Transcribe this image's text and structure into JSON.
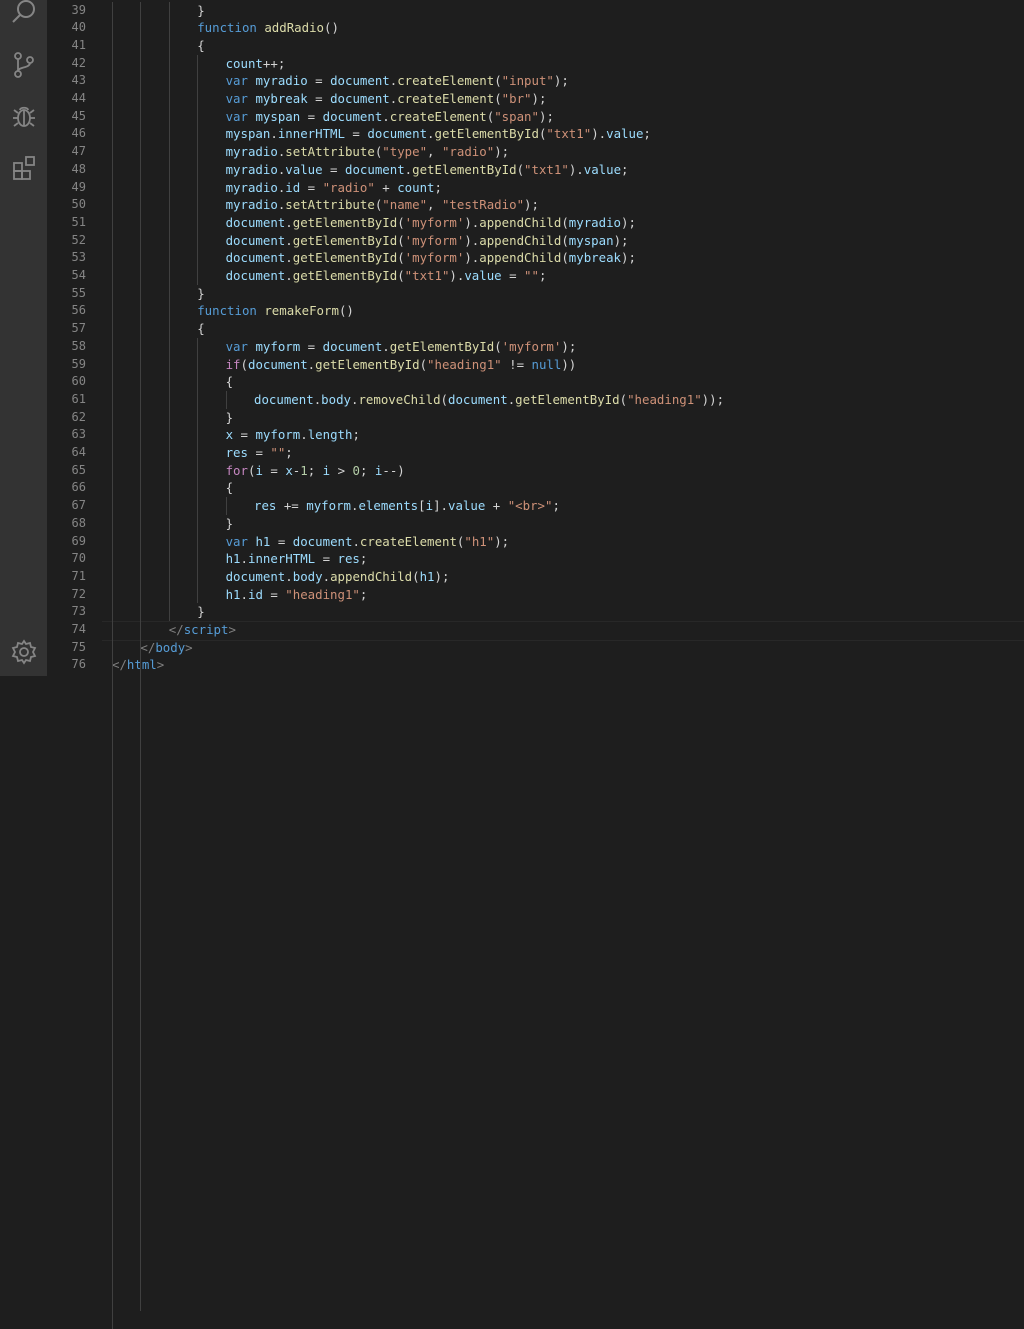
{
  "activity_bar": {
    "icons": [
      "search-icon",
      "source-control-icon",
      "debug-icon",
      "extensions-icon",
      "settings-gear-icon"
    ]
  },
  "colors": {
    "background": "#1e1e1e",
    "activity_bar": "#333333",
    "line_number": "#858585",
    "keyword": "#569cd6",
    "control": "#c586c0",
    "function": "#dcdcaa",
    "variable": "#9cdcfe",
    "string": "#ce9178",
    "number": "#b5cea8"
  },
  "editor": {
    "lines": [
      {
        "n": "39",
        "indent": 3,
        "tokens": [
          [
            "p",
            "}"
          ]
        ]
      },
      {
        "n": "40",
        "indent": 3,
        "tokens": [
          [
            "k",
            "function"
          ],
          [
            "p",
            " "
          ],
          [
            "f",
            "addRadio"
          ],
          [
            "p",
            "()"
          ]
        ]
      },
      {
        "n": "41",
        "indent": 3,
        "tokens": [
          [
            "p",
            "{"
          ]
        ]
      },
      {
        "n": "42",
        "indent": 4,
        "tokens": [
          [
            "v",
            "count"
          ],
          [
            "p",
            "++;"
          ]
        ]
      },
      {
        "n": "43",
        "indent": 4,
        "tokens": [
          [
            "k",
            "var"
          ],
          [
            "p",
            " "
          ],
          [
            "v",
            "myradio"
          ],
          [
            "p",
            " = "
          ],
          [
            "v",
            "document"
          ],
          [
            "p",
            "."
          ],
          [
            "f",
            "createElement"
          ],
          [
            "p",
            "("
          ],
          [
            "s",
            "\"input\""
          ],
          [
            "p",
            ");"
          ]
        ]
      },
      {
        "n": "44",
        "indent": 4,
        "tokens": [
          [
            "k",
            "var"
          ],
          [
            "p",
            " "
          ],
          [
            "v",
            "mybreak"
          ],
          [
            "p",
            " = "
          ],
          [
            "v",
            "document"
          ],
          [
            "p",
            "."
          ],
          [
            "f",
            "createElement"
          ],
          [
            "p",
            "("
          ],
          [
            "s",
            "\"br\""
          ],
          [
            "p",
            ");"
          ]
        ]
      },
      {
        "n": "45",
        "indent": 4,
        "tokens": [
          [
            "k",
            "var"
          ],
          [
            "p",
            " "
          ],
          [
            "v",
            "myspan"
          ],
          [
            "p",
            " = "
          ],
          [
            "v",
            "document"
          ],
          [
            "p",
            "."
          ],
          [
            "f",
            "createElement"
          ],
          [
            "p",
            "("
          ],
          [
            "s",
            "\"span\""
          ],
          [
            "p",
            ");"
          ]
        ]
      },
      {
        "n": "46",
        "indent": 4,
        "tokens": [
          [
            "v",
            "myspan"
          ],
          [
            "p",
            "."
          ],
          [
            "v",
            "innerHTML"
          ],
          [
            "p",
            " = "
          ],
          [
            "v",
            "document"
          ],
          [
            "p",
            "."
          ],
          [
            "f",
            "getElementById"
          ],
          [
            "p",
            "("
          ],
          [
            "s",
            "\"txt1\""
          ],
          [
            "p",
            ")."
          ],
          [
            "v",
            "value"
          ],
          [
            "p",
            ";"
          ]
        ]
      },
      {
        "n": "47",
        "indent": 4,
        "tokens": [
          [
            "v",
            "myradio"
          ],
          [
            "p",
            "."
          ],
          [
            "f",
            "setAttribute"
          ],
          [
            "p",
            "("
          ],
          [
            "s",
            "\"type\""
          ],
          [
            "p",
            ", "
          ],
          [
            "s",
            "\"radio\""
          ],
          [
            "p",
            ");"
          ]
        ]
      },
      {
        "n": "48",
        "indent": 4,
        "tokens": [
          [
            "v",
            "myradio"
          ],
          [
            "p",
            "."
          ],
          [
            "v",
            "value"
          ],
          [
            "p",
            " = "
          ],
          [
            "v",
            "document"
          ],
          [
            "p",
            "."
          ],
          [
            "f",
            "getElementById"
          ],
          [
            "p",
            "("
          ],
          [
            "s",
            "\"txt1\""
          ],
          [
            "p",
            ")."
          ],
          [
            "v",
            "value"
          ],
          [
            "p",
            ";"
          ]
        ]
      },
      {
        "n": "49",
        "indent": 4,
        "tokens": [
          [
            "v",
            "myradio"
          ],
          [
            "p",
            "."
          ],
          [
            "v",
            "id"
          ],
          [
            "p",
            " = "
          ],
          [
            "s",
            "\"radio\""
          ],
          [
            "p",
            " + "
          ],
          [
            "v",
            "count"
          ],
          [
            "p",
            ";"
          ]
        ]
      },
      {
        "n": "50",
        "indent": 4,
        "tokens": [
          [
            "v",
            "myradio"
          ],
          [
            "p",
            "."
          ],
          [
            "f",
            "setAttribute"
          ],
          [
            "p",
            "("
          ],
          [
            "s",
            "\"name\""
          ],
          [
            "p",
            ", "
          ],
          [
            "s",
            "\"testRadio\""
          ],
          [
            "p",
            ");"
          ]
        ]
      },
      {
        "n": "51",
        "indent": 4,
        "tokens": [
          [
            "v",
            "document"
          ],
          [
            "p",
            "."
          ],
          [
            "f",
            "getElementById"
          ],
          [
            "p",
            "("
          ],
          [
            "s",
            "'myform'"
          ],
          [
            "p",
            ")."
          ],
          [
            "f",
            "appendChild"
          ],
          [
            "p",
            "("
          ],
          [
            "v",
            "myradio"
          ],
          [
            "p",
            ");"
          ]
        ]
      },
      {
        "n": "52",
        "indent": 4,
        "tokens": [
          [
            "v",
            "document"
          ],
          [
            "p",
            "."
          ],
          [
            "f",
            "getElementById"
          ],
          [
            "p",
            "("
          ],
          [
            "s",
            "'myform'"
          ],
          [
            "p",
            ")."
          ],
          [
            "f",
            "appendChild"
          ],
          [
            "p",
            "("
          ],
          [
            "v",
            "myspan"
          ],
          [
            "p",
            ");"
          ]
        ]
      },
      {
        "n": "53",
        "indent": 4,
        "tokens": [
          [
            "v",
            "document"
          ],
          [
            "p",
            "."
          ],
          [
            "f",
            "getElementById"
          ],
          [
            "p",
            "("
          ],
          [
            "s",
            "'myform'"
          ],
          [
            "p",
            ")."
          ],
          [
            "f",
            "appendChild"
          ],
          [
            "p",
            "("
          ],
          [
            "v",
            "mybreak"
          ],
          [
            "p",
            ");"
          ]
        ]
      },
      {
        "n": "54",
        "indent": 4,
        "tokens": [
          [
            "v",
            "document"
          ],
          [
            "p",
            "."
          ],
          [
            "f",
            "getElementById"
          ],
          [
            "p",
            "("
          ],
          [
            "s",
            "\"txt1\""
          ],
          [
            "p",
            ")."
          ],
          [
            "v",
            "value"
          ],
          [
            "p",
            " = "
          ],
          [
            "s",
            "\"\""
          ],
          [
            "p",
            ";"
          ]
        ]
      },
      {
        "n": "55",
        "indent": 3,
        "tokens": [
          [
            "p",
            "}"
          ]
        ]
      },
      {
        "n": "56",
        "indent": 3,
        "tokens": [
          [
            "k",
            "function"
          ],
          [
            "p",
            " "
          ],
          [
            "f",
            "remakeForm"
          ],
          [
            "p",
            "()"
          ]
        ]
      },
      {
        "n": "57",
        "indent": 3,
        "tokens": [
          [
            "p",
            "{"
          ]
        ]
      },
      {
        "n": "58",
        "indent": 4,
        "tokens": [
          [
            "k",
            "var"
          ],
          [
            "p",
            " "
          ],
          [
            "v",
            "myform"
          ],
          [
            "p",
            " = "
          ],
          [
            "v",
            "document"
          ],
          [
            "p",
            "."
          ],
          [
            "f",
            "getElementById"
          ],
          [
            "p",
            "("
          ],
          [
            "s",
            "'myform'"
          ],
          [
            "p",
            ");"
          ]
        ]
      },
      {
        "n": "59",
        "indent": 4,
        "tokens": [
          [
            "c",
            "if"
          ],
          [
            "p",
            "("
          ],
          [
            "v",
            "document"
          ],
          [
            "p",
            "."
          ],
          [
            "f",
            "getElementById"
          ],
          [
            "p",
            "("
          ],
          [
            "s",
            "\"heading1\""
          ],
          [
            "p",
            " != "
          ],
          [
            "k",
            "null"
          ],
          [
            "p",
            "))"
          ]
        ]
      },
      {
        "n": "60",
        "indent": 4,
        "tokens": [
          [
            "p",
            "{"
          ]
        ]
      },
      {
        "n": "61",
        "indent": 5,
        "tokens": [
          [
            "v",
            "document"
          ],
          [
            "p",
            "."
          ],
          [
            "v",
            "body"
          ],
          [
            "p",
            "."
          ],
          [
            "f",
            "removeChild"
          ],
          [
            "p",
            "("
          ],
          [
            "v",
            "document"
          ],
          [
            "p",
            "."
          ],
          [
            "f",
            "getElementById"
          ],
          [
            "p",
            "("
          ],
          [
            "s",
            "\"heading1\""
          ],
          [
            "p",
            "));"
          ]
        ]
      },
      {
        "n": "62",
        "indent": 4,
        "tokens": [
          [
            "p",
            "}"
          ]
        ]
      },
      {
        "n": "63",
        "indent": 4,
        "tokens": [
          [
            "v",
            "x"
          ],
          [
            "p",
            " = "
          ],
          [
            "v",
            "myform"
          ],
          [
            "p",
            "."
          ],
          [
            "v",
            "length"
          ],
          [
            "p",
            ";"
          ]
        ]
      },
      {
        "n": "64",
        "indent": 4,
        "tokens": [
          [
            "v",
            "res"
          ],
          [
            "p",
            " = "
          ],
          [
            "s",
            "\"\""
          ],
          [
            "p",
            ";"
          ]
        ]
      },
      {
        "n": "65",
        "indent": 4,
        "tokens": [
          [
            "c",
            "for"
          ],
          [
            "p",
            "("
          ],
          [
            "v",
            "i"
          ],
          [
            "p",
            " = "
          ],
          [
            "v",
            "x"
          ],
          [
            "p",
            "-"
          ],
          [
            "n",
            "1"
          ],
          [
            "p",
            "; "
          ],
          [
            "v",
            "i"
          ],
          [
            "p",
            " > "
          ],
          [
            "n",
            "0"
          ],
          [
            "p",
            "; "
          ],
          [
            "v",
            "i"
          ],
          [
            "p",
            "--)"
          ]
        ]
      },
      {
        "n": "66",
        "indent": 4,
        "tokens": [
          [
            "p",
            "{"
          ]
        ]
      },
      {
        "n": "67",
        "indent": 5,
        "tokens": [
          [
            "v",
            "res"
          ],
          [
            "p",
            " += "
          ],
          [
            "v",
            "myform"
          ],
          [
            "p",
            "."
          ],
          [
            "v",
            "elements"
          ],
          [
            "p",
            "["
          ],
          [
            "v",
            "i"
          ],
          [
            "p",
            "]."
          ],
          [
            "v",
            "value"
          ],
          [
            "p",
            " + "
          ],
          [
            "s",
            "\"<br>\""
          ],
          [
            "p",
            ";"
          ]
        ]
      },
      {
        "n": "68",
        "indent": 4,
        "tokens": [
          [
            "p",
            "}"
          ]
        ]
      },
      {
        "n": "69",
        "indent": 4,
        "tokens": [
          [
            "k",
            "var"
          ],
          [
            "p",
            " "
          ],
          [
            "v",
            "h1"
          ],
          [
            "p",
            " = "
          ],
          [
            "v",
            "document"
          ],
          [
            "p",
            "."
          ],
          [
            "f",
            "createElement"
          ],
          [
            "p",
            "("
          ],
          [
            "s",
            "\"h1\""
          ],
          [
            "p",
            ");"
          ]
        ]
      },
      {
        "n": "70",
        "indent": 4,
        "tokens": [
          [
            "v",
            "h1"
          ],
          [
            "p",
            "."
          ],
          [
            "v",
            "innerHTML"
          ],
          [
            "p",
            " = "
          ],
          [
            "v",
            "res"
          ],
          [
            "p",
            ";"
          ]
        ]
      },
      {
        "n": "71",
        "indent": 4,
        "tokens": [
          [
            "v",
            "document"
          ],
          [
            "p",
            "."
          ],
          [
            "v",
            "body"
          ],
          [
            "p",
            "."
          ],
          [
            "f",
            "appendChild"
          ],
          [
            "p",
            "("
          ],
          [
            "v",
            "h1"
          ],
          [
            "p",
            ");"
          ]
        ]
      },
      {
        "n": "72",
        "indent": 4,
        "tokens": [
          [
            "v",
            "h1"
          ],
          [
            "p",
            "."
          ],
          [
            "v",
            "id"
          ],
          [
            "p",
            " = "
          ],
          [
            "s",
            "\"heading1\""
          ],
          [
            "p",
            ";"
          ]
        ]
      },
      {
        "n": "73",
        "indent": 3,
        "tokens": [
          [
            "p",
            "}"
          ]
        ]
      },
      {
        "n": "74",
        "indent": 2,
        "tokens": [
          [
            "t",
            "</"
          ],
          [
            "tg",
            "script"
          ],
          [
            "t",
            ">"
          ]
        ]
      },
      {
        "n": "75",
        "indent": 1,
        "tokens": [
          [
            "t",
            "</"
          ],
          [
            "tg",
            "body"
          ],
          [
            "t",
            ">"
          ]
        ]
      },
      {
        "n": "76",
        "indent": 0,
        "tokens": [
          [
            "t",
            "</"
          ],
          [
            "tg",
            "html"
          ],
          [
            "t",
            ">"
          ]
        ]
      }
    ]
  }
}
